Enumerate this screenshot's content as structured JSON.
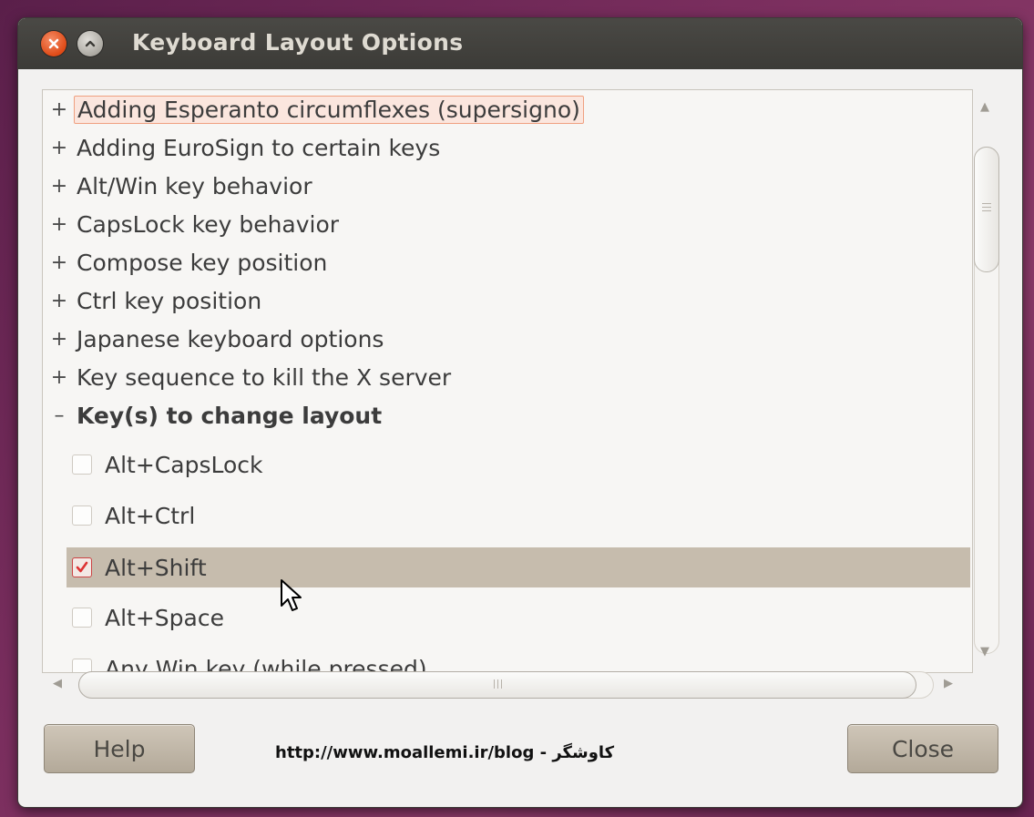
{
  "window": {
    "title": "Keyboard Layout Options"
  },
  "tree": {
    "items": [
      {
        "label": "Adding Esperanto circumflexes (supersigno)",
        "expanded": false
      },
      {
        "label": "Adding EuroSign to certain keys",
        "expanded": false
      },
      {
        "label": "Alt/Win key behavior",
        "expanded": false
      },
      {
        "label": "CapsLock key behavior",
        "expanded": false
      },
      {
        "label": "Compose key position",
        "expanded": false
      },
      {
        "label": "Ctrl key position",
        "expanded": false
      },
      {
        "label": "Japanese keyboard options",
        "expanded": false
      },
      {
        "label": "Key sequence to kill the X server",
        "expanded": false
      },
      {
        "label": "Key(s) to change layout",
        "expanded": true
      }
    ],
    "expander_collapsed": "+",
    "expander_expanded": "–",
    "options": [
      {
        "label": "Alt+CapsLock",
        "checked": false
      },
      {
        "label": "Alt+Ctrl",
        "checked": false
      },
      {
        "label": "Alt+Shift",
        "checked": true
      },
      {
        "label": "Alt+Space",
        "checked": false
      },
      {
        "label": "Any Win key (while pressed)",
        "checked": false
      }
    ]
  },
  "buttons": {
    "help": "Help",
    "close": "Close"
  },
  "watermark": "http://www.moallemi.ir/blog - کاوشگر",
  "colors": {
    "titlebar": "#3c3b37",
    "selected_row": "#c6bcad",
    "close_button": "#df4a16",
    "check_mark": "#d33"
  },
  "icons": {
    "close": "close-icon",
    "maximize": "maximize-icon",
    "cursor": "mouse-cursor-icon"
  }
}
